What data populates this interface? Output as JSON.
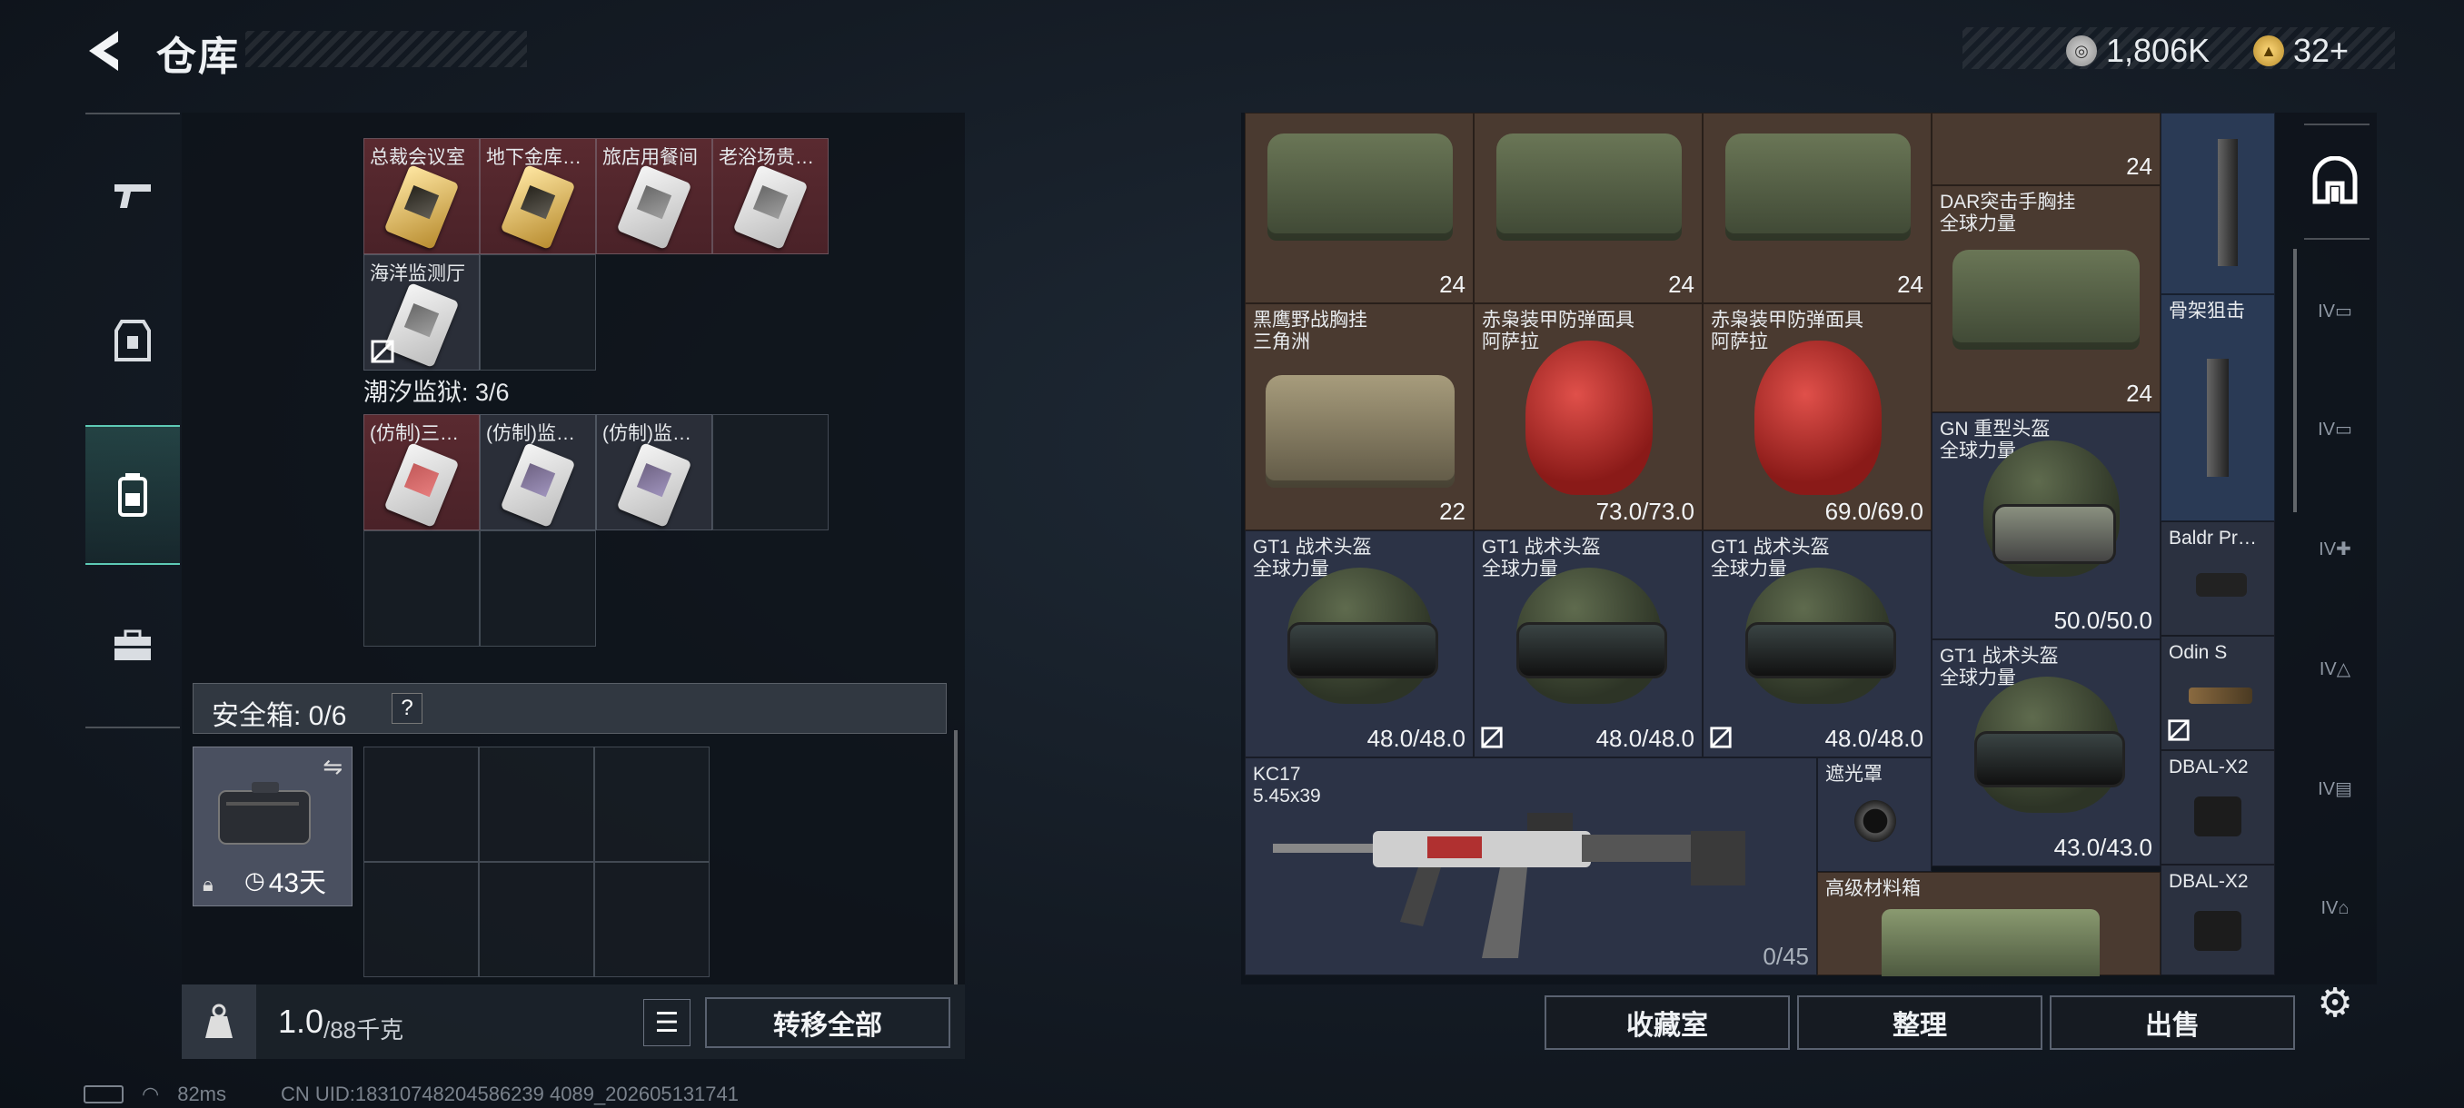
{
  "header": {
    "title": "仓库",
    "currency": [
      {
        "icon": "silver-coin-icon",
        "value": "1,806K"
      },
      {
        "icon": "gold-coin-icon",
        "value": "32+"
      }
    ]
  },
  "nav": {
    "items": [
      {
        "icon": "gun-icon"
      },
      {
        "icon": "armor-icon"
      },
      {
        "icon": "backpack-icon",
        "active": true
      },
      {
        "icon": "toolbox-icon"
      }
    ]
  },
  "left": {
    "row1": [
      "总裁会议室",
      "地下金库…",
      "旅店用餐间",
      "老浴场贵…"
    ],
    "row2": [
      "海洋监测厅"
    ],
    "section": "潮汐监狱: 3/6",
    "row3": [
      "(仿制)三…",
      "(仿制)监…",
      "(仿制)监…"
    ],
    "safe_label": "安全箱: 0/6",
    "safe_help": "?",
    "safe_days": "43天",
    "weight": "1.0",
    "weight_max": "/88千克",
    "transfer_all": "转移全部"
  },
  "right": {
    "counts": [
      "24",
      "24",
      "24",
      "24",
      "24",
      "22"
    ],
    "dar": [
      "DAR突击手胸挂",
      "全球力量"
    ],
    "bone": "骨架狙击",
    "hawk": [
      "黑鹰野战胸挂",
      "三角洲"
    ],
    "mask1": [
      "赤枭装甲防弹面具",
      "阿萨拉"
    ],
    "mask2": [
      "赤枭装甲防弹面具",
      "阿萨拉"
    ],
    "mask1_dur": "73.0/73.0",
    "mask2_dur": "69.0/69.0",
    "gn": [
      "GN 重型头盔",
      "全球力量"
    ],
    "gn_dur": "50.0/50.0",
    "gt1": [
      "GT1 战术头盔",
      "全球力量"
    ],
    "gt1_dur": "48.0/48.0",
    "gt1b_dur": "43.0/43.0",
    "baldr": "Baldr Pr…",
    "odin": "Odin S",
    "kc17": [
      "KC17",
      "5.45x39"
    ],
    "kc17_ammo": "0/45",
    "shade": "遮光罩",
    "dbal": "DBAL-X2",
    "dbal2": "DBAL-X2",
    "crate": "高级材料箱",
    "buttons": [
      "收藏室",
      "整理",
      "出售"
    ]
  },
  "status": {
    "ping": "82ms",
    "uid": "CN UID:18310748204586239 4089_202605131741"
  }
}
